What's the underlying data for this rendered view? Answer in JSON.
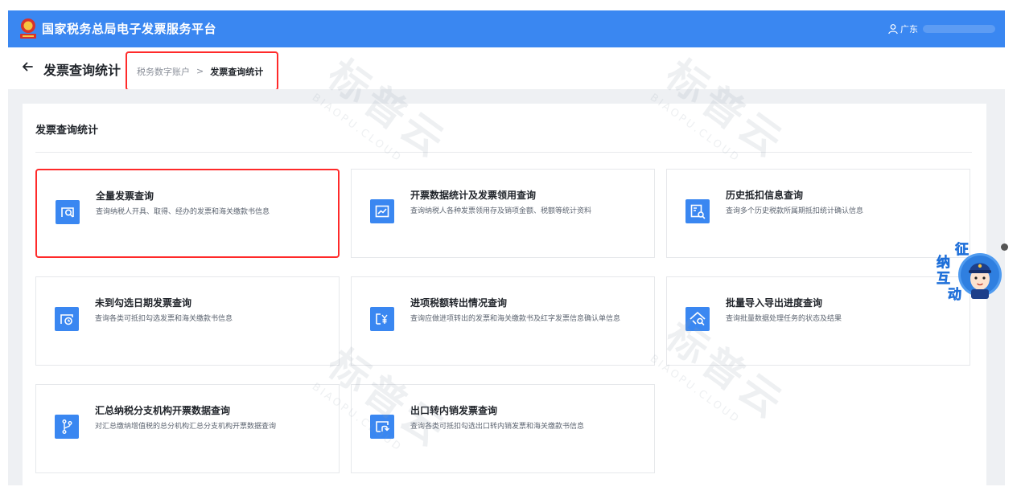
{
  "header": {
    "app_title": "国家税务总局电子发票服务平台",
    "user_name": "广东"
  },
  "titlebar": {
    "page_title": "发票查询统计",
    "breadcrumb": [
      "税务数字账户",
      "发票查询统计"
    ],
    "breadcrumb_separator": ">"
  },
  "section": {
    "title": "发票查询统计"
  },
  "cards": [
    {
      "title": "全量发票查询",
      "desc": "查询纳税人开具、取得、经办的发票和海关缴款书信息",
      "icon": "invoice-search-icon",
      "selected": true
    },
    {
      "title": "开票数据统计及发票领用查询",
      "desc": "查询纳税人各种发票领用存及销项金额、税额等统计资料",
      "icon": "trend-chart-icon",
      "selected": false
    },
    {
      "title": "历史抵扣信息查询",
      "desc": "查询多个历史税款所属期抵扣统计确认信息",
      "icon": "history-search-icon",
      "selected": false
    },
    {
      "title": "未到勾选日期发票查询",
      "desc": "查询各类可抵扣勾选发票和海关缴款书信息",
      "icon": "clock-icon",
      "selected": false
    },
    {
      "title": "进项税额转出情况查询",
      "desc": "查询应做进项转出的发票和海关缴款书及红字发票信息确认单信息",
      "icon": "yen-document-icon",
      "selected": false
    },
    {
      "title": "批量导入导出进度查询",
      "desc": "查询批量数据处理任务的状态及结果",
      "icon": "batch-progress-icon",
      "selected": false
    },
    {
      "title": "汇总纳税分支机构开票数据查询",
      "desc": "对汇总缴纳增值税的总分机构汇总分支机构开票数据查询",
      "icon": "branch-icon",
      "selected": false
    },
    {
      "title": "出口转内销发票查询",
      "desc": "查询各类可抵扣勾选出口转内销发票和海关缴款书信息",
      "icon": "export-return-icon",
      "selected": false
    }
  ],
  "helper": {
    "label": [
      "征",
      "纳",
      "互",
      "动"
    ]
  },
  "watermark": {
    "text_cn": "标普云",
    "text_en": "BIAOPU.CLOUD"
  },
  "colors": {
    "header_bg": "#3a87f1",
    "icon_bg": "#3a87f1",
    "highlight_border": "#ff2a2a",
    "content_bg": "#eef0f3"
  }
}
